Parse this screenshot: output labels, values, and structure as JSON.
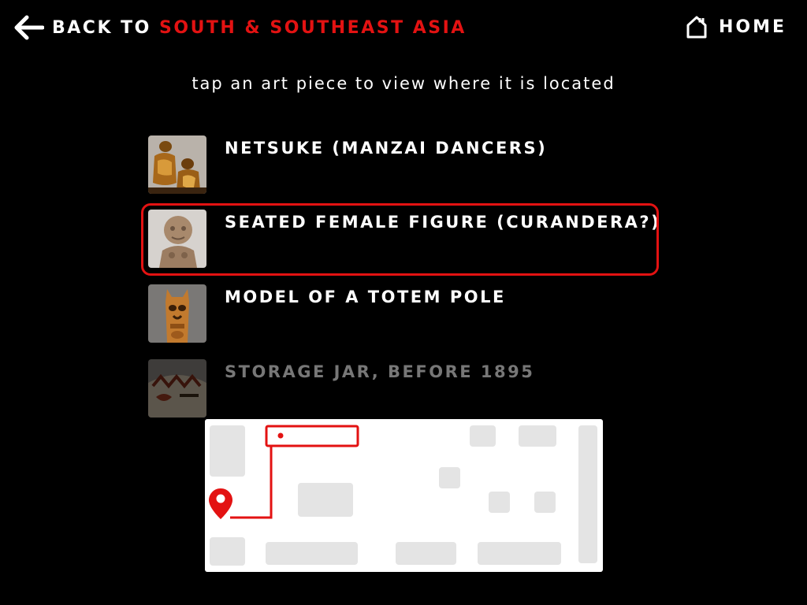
{
  "nav": {
    "back_prefix": "BACK TO ",
    "back_destination": "SOUTH & SOUTHEAST ASIA",
    "home_label": "HOME",
    "back_icon": "arrow-left-icon",
    "home_icon": "home-icon"
  },
  "instruction": "tap an art piece to view where it is located",
  "art_pieces": [
    {
      "title": "NETSUKE (MANZAI DANCERS)",
      "thumbnail": "netsuke-thumbnail",
      "state": "normal"
    },
    {
      "title": "SEATED FEMALE FIGURE (CURANDERA?)",
      "thumbnail": "seated-figure-thumbnail",
      "state": "selected"
    },
    {
      "title": "MODEL OF A TOTEM POLE",
      "thumbnail": "totem-pole-thumbnail",
      "state": "normal"
    },
    {
      "title": "STORAGE JAR, BEFORE 1895",
      "thumbnail": "storage-jar-thumbnail",
      "state": "faded"
    }
  ],
  "map": {
    "location_icon": "location-pin-icon",
    "highlighted_room": "selected-piece-room"
  },
  "colors": {
    "accent": "#e31212",
    "background": "#000000",
    "text": "#ffffff",
    "faded_text": "#777777",
    "map_background": "#ffffff",
    "map_room": "#e4e4e4"
  }
}
